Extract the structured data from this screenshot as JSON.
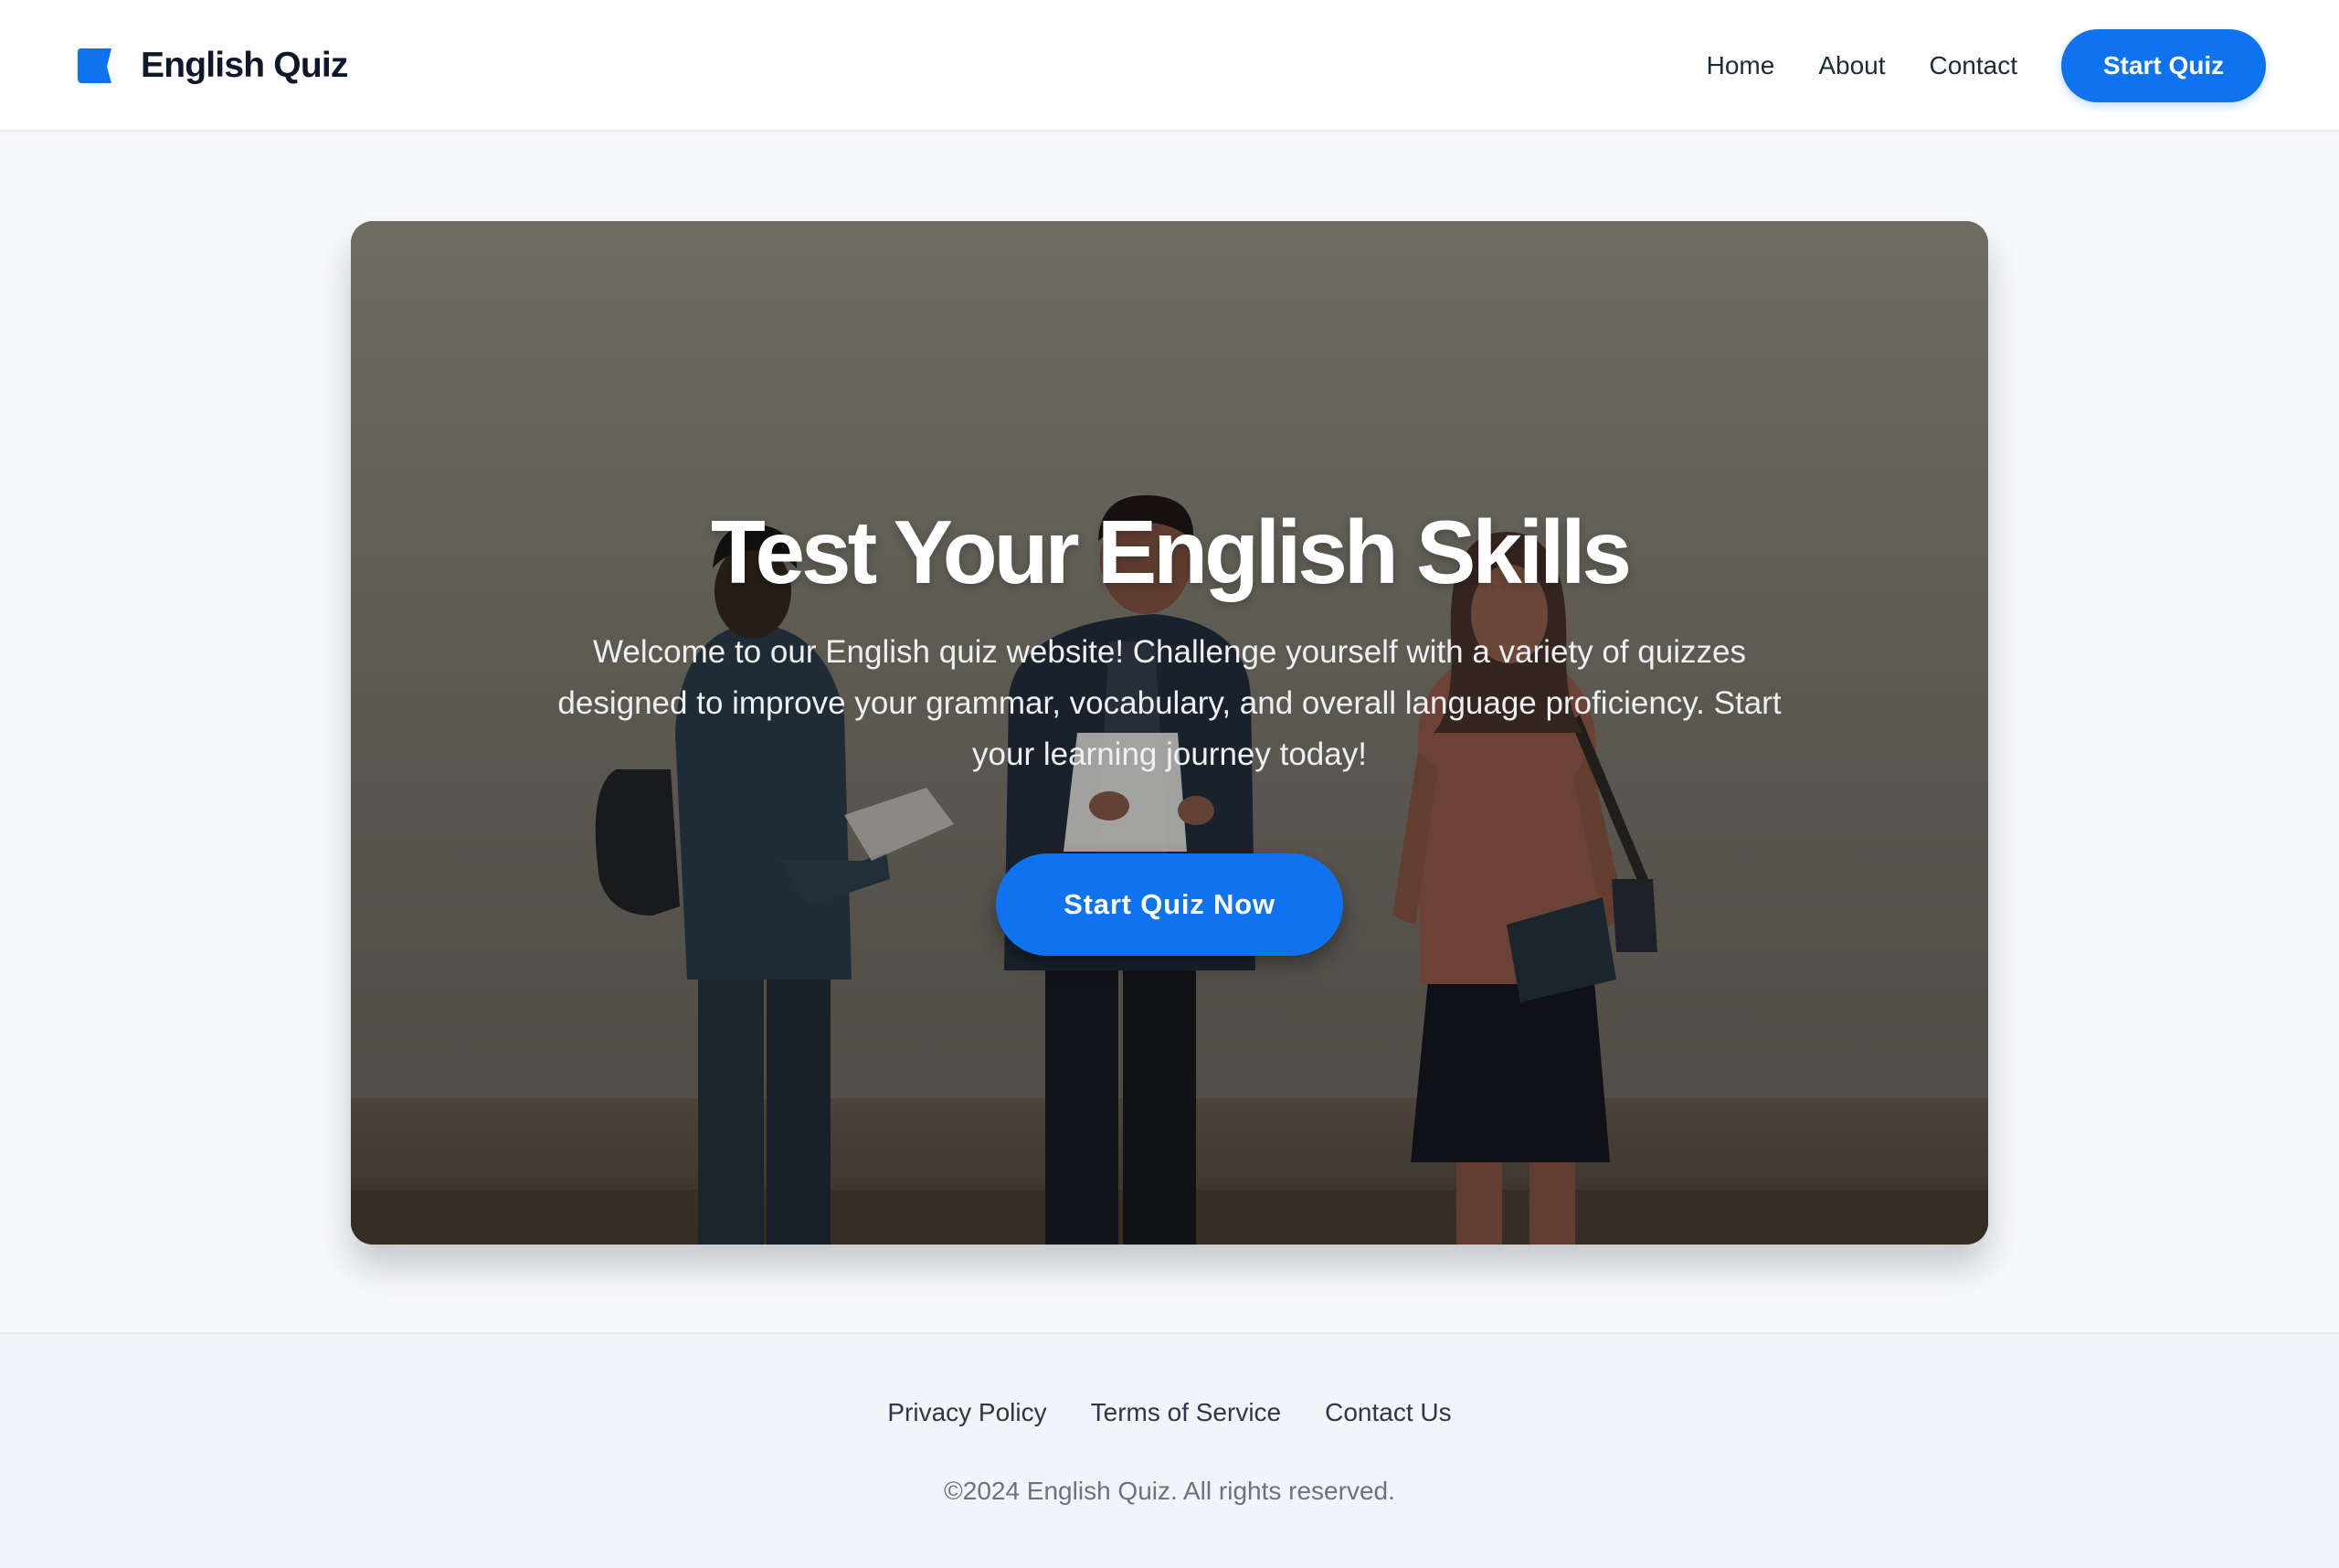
{
  "header": {
    "brand_icon": "book-icon",
    "brand_name": "English Quiz",
    "nav": {
      "home": "Home",
      "about": "About",
      "contact": "Contact"
    },
    "cta_label": "Start Quiz"
  },
  "hero": {
    "title": "Test Your English Skills",
    "description": "Welcome to our English quiz website! Challenge yourself with a variety of quizzes designed to improve your grammar, vocabulary, and overall language proficiency. Start your learning journey today!",
    "cta_label": "Start Quiz Now"
  },
  "footer": {
    "links": {
      "privacy": "Privacy Policy",
      "terms": "Terms of Service",
      "contact": "Contact Us"
    },
    "copyright": "©2024 English Quiz. All rights reserved."
  },
  "colors": {
    "accent": "#0f73ef",
    "text_dark": "#0f172a",
    "page_background": "#f8f9fb",
    "footer_background": "#f1f4f8"
  }
}
